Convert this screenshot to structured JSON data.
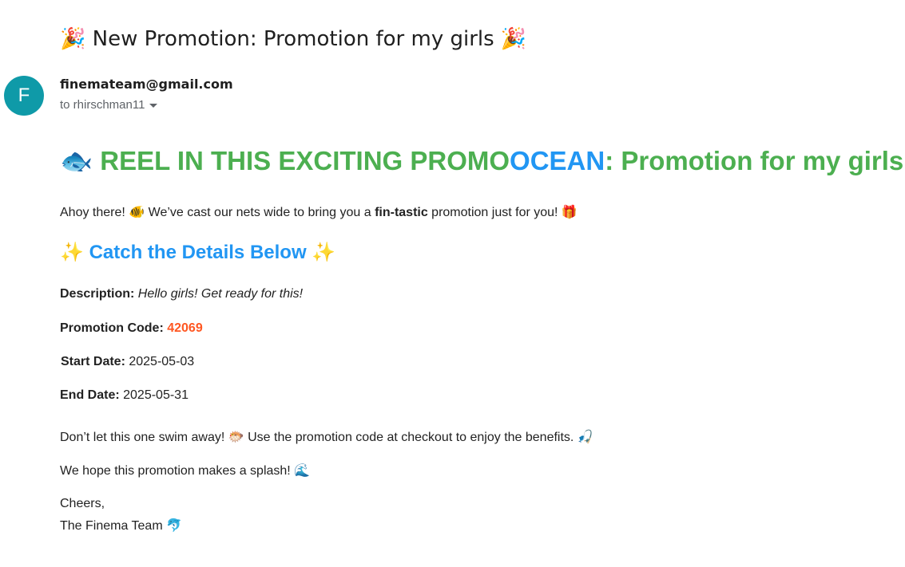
{
  "email": {
    "subject_prefix_emoji": "🎉",
    "subject": "New Promotion: Promotion for my girls",
    "subject_suffix_emoji": "🎉",
    "avatar_letter": "F",
    "sender": "finemateam@gmail.com",
    "recipient": "to rhirschman11"
  },
  "content": {
    "headline_emoji_left": "🐟",
    "headline_part1": "REEL IN THIS EXCITING PROMO",
    "headline_part2": "OCEAN",
    "headline_part3": ": Promotion for my girls",
    "headline_emoji_right": "🌊",
    "intro_1": "Ahoy there! ",
    "intro_emoji_fish": "🐠",
    "intro_2": " We’ve cast our nets wide to bring you a ",
    "intro_bold": "fin-tastic",
    "intro_3": " promotion just for you! ",
    "intro_emoji_gift": "🎁",
    "details_heading_emoji": "✨",
    "details_heading": "Catch the Details Below",
    "description_label": "Description:",
    "description_value": "Hello girls! Get ready for this!",
    "code_label": "Promotion Code:",
    "code_value": "42069",
    "start_label": "Start Date:",
    "start_value": "2025-05-03",
    "end_label": "End Date:",
    "end_value": "2025-05-31",
    "cta_1": "Don’t let this one swim away! ",
    "cta_emoji_blowfish": "🐡",
    "cta_2": " Use the promotion code at checkout to enjoy the benefits. ",
    "cta_emoji_rod": "🎣",
    "splash_text": "We hope this promotion makes a splash! ",
    "splash_emoji": "🌊",
    "signoff": "Cheers,",
    "signature": "The Finema Team ",
    "signature_emoji": "🐬"
  },
  "colors": {
    "headline_green": "#4caf50",
    "headline_blue": "#2196f3",
    "code_orange": "#ff5722",
    "avatar_teal": "#0f9aa8"
  }
}
